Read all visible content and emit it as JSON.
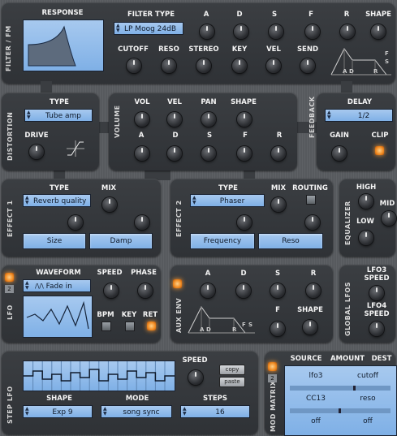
{
  "filter": {
    "side_label": "FILTER / FM",
    "response_label": "RESPONSE",
    "filter_type_label": "FILTER TYPE",
    "filter_type_value": "LP Moog 24dB",
    "knobs_top": [
      "A",
      "D",
      "S",
      "F",
      "R",
      "SHAPE"
    ],
    "knobs_bottom": [
      "CUTOFF",
      "RESO",
      "STEREO",
      "KEY",
      "VEL",
      "SEND"
    ],
    "env_labels": [
      "A",
      "D",
      "R",
      "F",
      "S"
    ]
  },
  "distortion": {
    "side_label": "DISTORTION",
    "type_label": "TYPE",
    "type_value": "Tube amp",
    "drive_label": "DRIVE"
  },
  "volume": {
    "side_label": "VOLUME",
    "top": [
      "VOL",
      "VEL",
      "PAN",
      "SHAPE"
    ],
    "bottom": [
      "A",
      "D",
      "S",
      "F",
      "R"
    ]
  },
  "feedback": {
    "side_label": "FEEDBACK",
    "delay_label": "DELAY",
    "delay_value": "1/2",
    "gain_label": "GAIN",
    "clip_label": "CLIP"
  },
  "effect1": {
    "side_label": "EFFECT 1",
    "type_label": "TYPE",
    "type_value": "Reverb quality",
    "mix_label": "MIX",
    "param1": "Size",
    "param2": "Damp"
  },
  "effect2": {
    "side_label": "EFFECT 2",
    "type_label": "TYPE",
    "type_value": "Phaser",
    "mix_label": "MIX",
    "routing_label": "ROUTING",
    "param1": "Frequency",
    "param2": "Reso"
  },
  "equalizer": {
    "side_label": "EQUALIZER",
    "high": "HIGH",
    "mid": "MID",
    "low": "LOW"
  },
  "lfo": {
    "side_label": "LFO",
    "number": "2",
    "waveform_label": "WAVEFORM",
    "waveform_value": "Fade in",
    "speed_label": "SPEED",
    "phase_label": "PHASE",
    "bpm_label": "BPM",
    "key_label": "KEY",
    "ret_label": "RET"
  },
  "aux_env": {
    "side_label": "AUX ENV",
    "labels": [
      "A",
      "D",
      "S",
      "R"
    ],
    "f_label": "F",
    "shape_label": "SHAPE",
    "env_labels": [
      "A",
      "D",
      "R",
      "F",
      "S"
    ]
  },
  "global_lfos": {
    "side_label": "GLOBAL LFOS",
    "lfo3": "LFO3",
    "lfo3_speed": "SPEED",
    "lfo4": "LFO4",
    "lfo4_speed": "SPEED"
  },
  "step_lfo": {
    "side_label": "STEP LFO",
    "speed_label": "SPEED",
    "copy_label": "copy",
    "paste_label": "paste",
    "shape_label": "SHAPE",
    "shape_value": "Exp 9",
    "mode_label": "MODE",
    "mode_value": "song sync",
    "steps_label": "STEPS",
    "steps_value": "16"
  },
  "mod_matrix": {
    "side_label": "MOD MATRIX",
    "number": "2",
    "headers": [
      "SOURCE",
      "AMOUNT",
      "DEST"
    ],
    "rows": [
      {
        "source": "lfo3",
        "dest": "cutoff"
      },
      {
        "source": "CC13",
        "dest": "reso"
      },
      {
        "source": "off",
        "dest": "off"
      }
    ]
  },
  "colors": {
    "lcd": "#8dbbec",
    "led": "#f08a20",
    "panel": "#33363a"
  }
}
